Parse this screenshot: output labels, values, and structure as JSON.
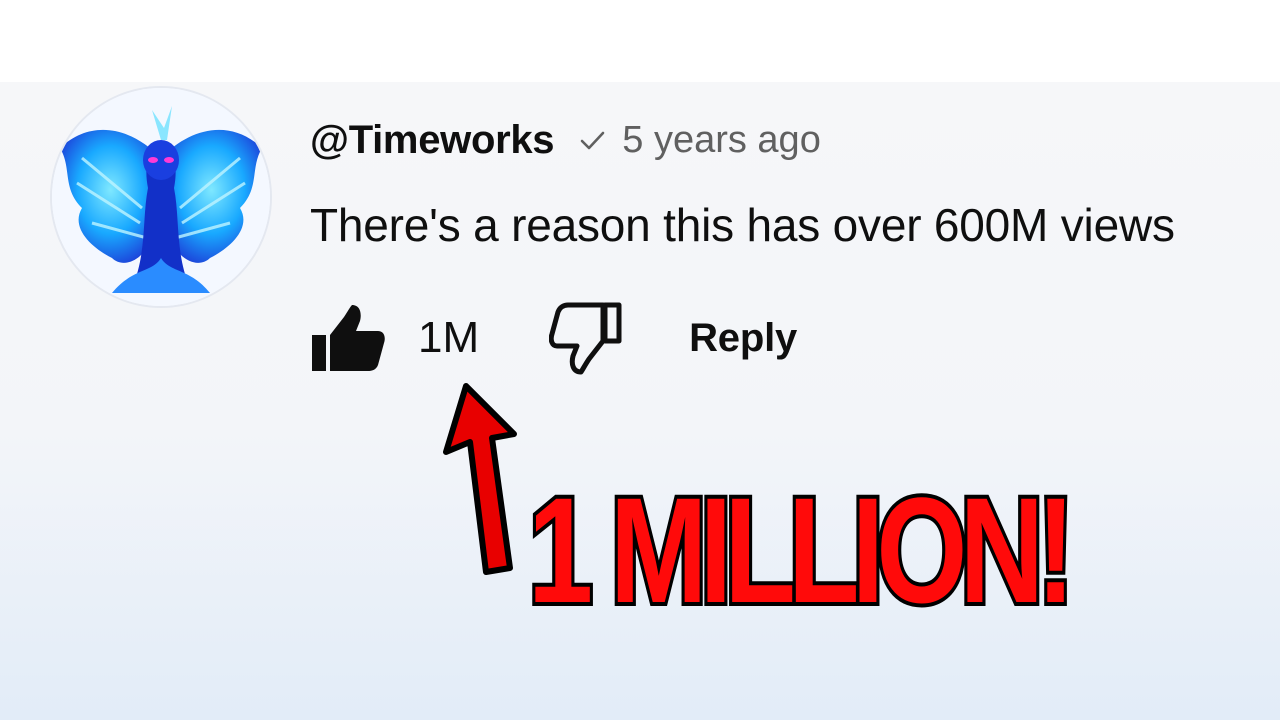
{
  "comment": {
    "author": "@Timeworks",
    "verified_icon": "checkmark-icon",
    "timestamp": "5 years ago",
    "text": "There's a reason this has over 600M views",
    "likes": "1M",
    "reply_label": "Reply"
  },
  "annotation": {
    "callout_text": "1 MILLION!",
    "callout_color": "#ff0a0a",
    "arrow_color": "#e80000"
  },
  "colors": {
    "card_background": "#f3f5f9",
    "text_primary": "#0f0f0f",
    "text_secondary": "#606060",
    "avatar_accent": "#1e5dff"
  }
}
